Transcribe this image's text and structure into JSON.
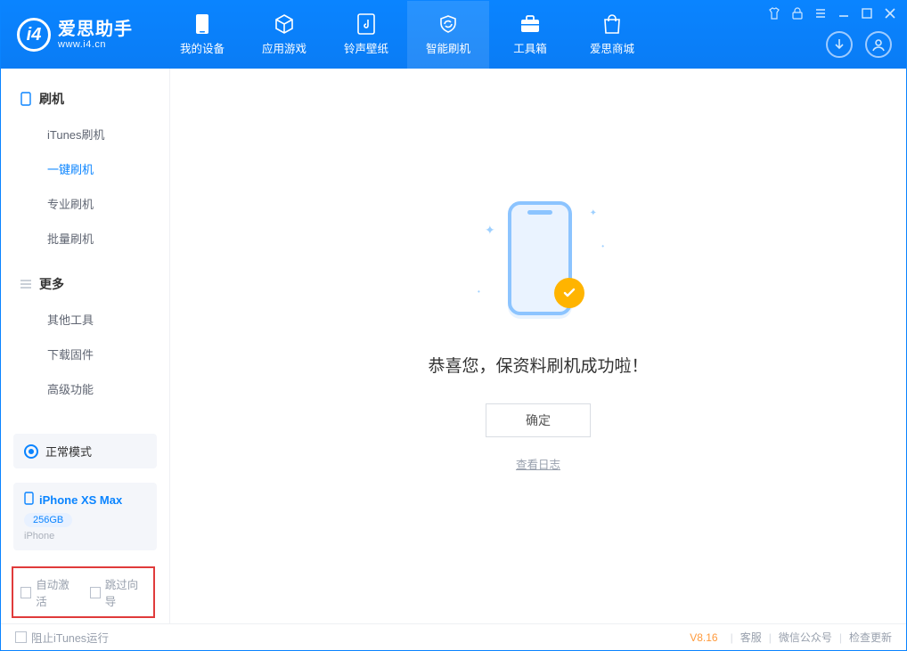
{
  "brand": {
    "title": "爱思助手",
    "subtitle": "www.i4.cn"
  },
  "nav": {
    "items": [
      {
        "label": "我的设备"
      },
      {
        "label": "应用游戏"
      },
      {
        "label": "铃声壁纸"
      },
      {
        "label": "智能刷机"
      },
      {
        "label": "工具箱"
      },
      {
        "label": "爱思商城"
      }
    ]
  },
  "sidebar": {
    "section1_title": "刷机",
    "section1_items": [
      "iTunes刷机",
      "一键刷机",
      "专业刷机",
      "批量刷机"
    ],
    "section2_title": "更多",
    "section2_items": [
      "其他工具",
      "下载固件",
      "高级功能"
    ]
  },
  "mode": {
    "label": "正常模式"
  },
  "device": {
    "name": "iPhone XS Max",
    "capacity": "256GB",
    "type": "iPhone"
  },
  "checks": {
    "auto_activate": "自动激活",
    "skip_guide": "跳过向导"
  },
  "main": {
    "success_title": "恭喜您，保资料刷机成功啦！",
    "ok_button": "确定",
    "view_log": "查看日志"
  },
  "footer": {
    "block_itunes": "阻止iTunes运行",
    "version": "V8.16",
    "links": [
      "客服",
      "微信公众号",
      "检查更新"
    ]
  }
}
